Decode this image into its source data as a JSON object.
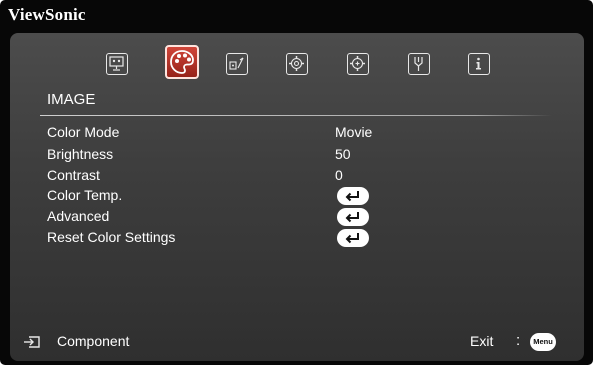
{
  "brand": "ViewSonic",
  "tabs": [
    {
      "name": "display",
      "icon": "display-screen-icon",
      "active": false
    },
    {
      "name": "image",
      "icon": "palette-icon",
      "active": true
    },
    {
      "name": "audio",
      "icon": "sound-settings-icon",
      "active": false
    },
    {
      "name": "basic",
      "icon": "basic-gear-icon",
      "active": false
    },
    {
      "name": "advanced",
      "icon": "advanced-gear-icon",
      "active": false
    },
    {
      "name": "system",
      "icon": "tools-icon",
      "active": false
    },
    {
      "name": "information",
      "icon": "information-icon",
      "active": false
    }
  ],
  "section_title": "IMAGE",
  "rows": [
    {
      "label": "Color Mode",
      "value": "Movie",
      "type": "value"
    },
    {
      "label": "Brightness",
      "value": "50",
      "type": "value"
    },
    {
      "label": "Contrast",
      "value": "0",
      "type": "value"
    },
    {
      "label": "Color Temp.",
      "type": "enter"
    },
    {
      "label": "Advanced",
      "type": "enter"
    },
    {
      "label": "Reset Color Settings",
      "type": "enter"
    }
  ],
  "footer": {
    "source_label": "Component",
    "exit_label": "Exit",
    "separator": ":",
    "menu_button_label": "Menu"
  },
  "colors": {
    "active_tab": "#c0392b",
    "panel": "#444444",
    "text": "#ffffff"
  }
}
